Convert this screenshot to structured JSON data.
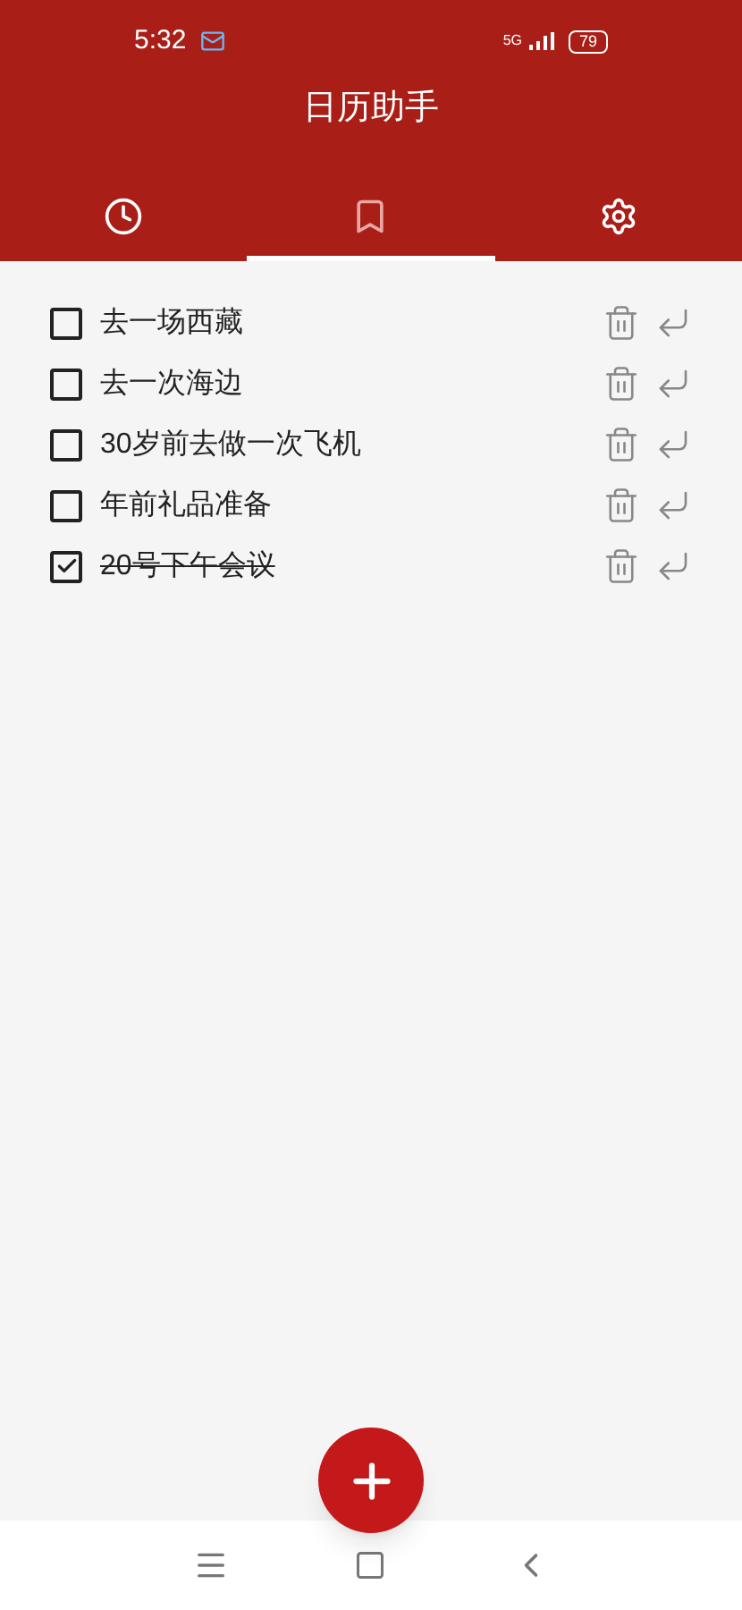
{
  "status_bar": {
    "time": "5:32",
    "network": "5G",
    "battery": "79"
  },
  "app_bar": {
    "title": "日历助手"
  },
  "tabs": [
    {
      "kind": "clock",
      "selected": false
    },
    {
      "kind": "bookmark",
      "selected": true
    },
    {
      "kind": "settings",
      "selected": false
    }
  ],
  "todos": [
    {
      "text": "去一场西藏",
      "checked": false
    },
    {
      "text": "去一次海边",
      "checked": false
    },
    {
      "text": "30岁前去做一次飞机",
      "checked": false
    },
    {
      "text": "年前礼品准备",
      "checked": false
    },
    {
      "text": "20号下午会议",
      "checked": true
    }
  ]
}
